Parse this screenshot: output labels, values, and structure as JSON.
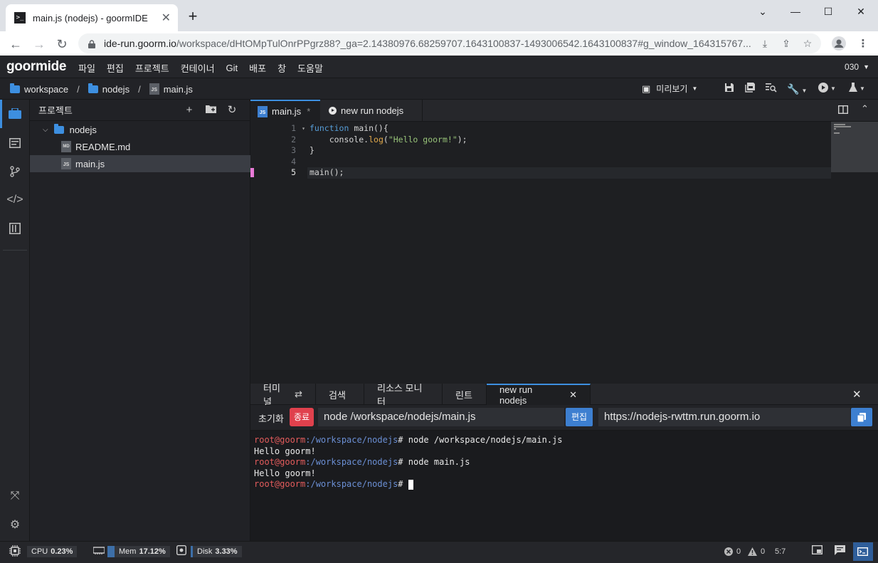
{
  "browser": {
    "tab_title": "main.js (nodejs) - goormIDE",
    "url_host": "ide-run.goorm.io",
    "url_path": "/workspace/dHtOMpTulOnrPPgrz88?_ga=2.14380976.68259707.1643100837-1493006542.1643100837#g_window_164315767..."
  },
  "menu": {
    "logo": "goormide",
    "items": [
      "파일",
      "편집",
      "프로젝트",
      "컨테이너",
      "Git",
      "배포",
      "창",
      "도움말"
    ],
    "user": "030"
  },
  "breadcrumb": [
    "workspace",
    "nodejs",
    "main.js"
  ],
  "toolbar": {
    "preview_label": "미리보기"
  },
  "project": {
    "header": "프로젝트",
    "root": "nodejs",
    "files": [
      {
        "name": "README.md",
        "type": "MD"
      },
      {
        "name": "main.js",
        "type": "JS"
      }
    ]
  },
  "editor": {
    "tabs": [
      {
        "label": "main.js",
        "modified": "*"
      },
      {
        "label": "new run nodejs"
      }
    ],
    "line_numbers": [
      "1",
      "2",
      "3",
      "4",
      "5"
    ],
    "code": {
      "l1_kw": "function",
      "l1_rest": " main(){",
      "l2_a": "    console.",
      "l2_fn": "log",
      "l2_b": "(",
      "l2_str": "\"Hello goorm!\"",
      "l2_c": ");",
      "l3": "}",
      "l4": "",
      "l5": "main();"
    }
  },
  "bottom": {
    "tabs": [
      "터미널",
      "검색",
      "리소스 모니터",
      "린트",
      "new run nodejs"
    ],
    "reset_label": "초기화",
    "stop_label": "종료",
    "command": "node /workspace/nodejs/main.js",
    "edit_label": "편집",
    "run_url": "https://nodejs-rwttm.run.goorm.io"
  },
  "terminal": {
    "user": "root@goorm",
    "path": ":/workspace/nodejs",
    "prompt": "# ",
    "cmd1": "node /workspace/nodejs/main.js",
    "out1": "Hello goorm!",
    "cmd2": "node main.js",
    "out2": "Hello goorm!"
  },
  "status": {
    "cpu_label": "CPU",
    "cpu_value": "0.23%",
    "mem_label": "Mem",
    "mem_value": "17.12%",
    "disk_label": "Disk",
    "disk_value": "3.33%",
    "errors": "0",
    "warnings": "0",
    "cursor": "5:7"
  }
}
